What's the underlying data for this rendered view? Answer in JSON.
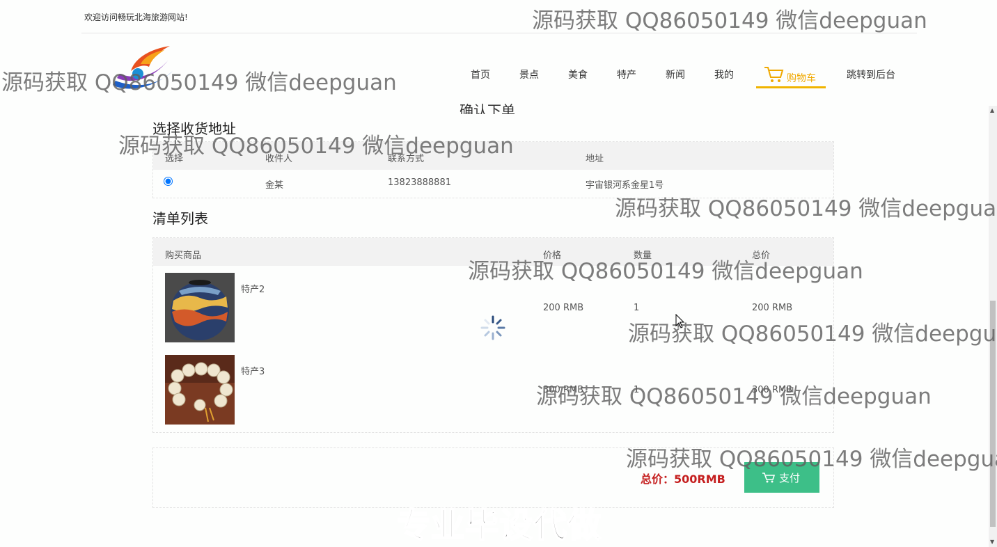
{
  "header": {
    "welcome": "欢迎访问畅玩北海旅游网站!",
    "nav": [
      "首页",
      "景点",
      "美食",
      "特产",
      "新闻",
      "我的"
    ],
    "cart_label": "购物车",
    "admin_link": "跳转到后台"
  },
  "page_heading": "确认下单",
  "address_section": {
    "title": "选择收货地址",
    "columns": [
      "选择",
      "收件人",
      "联系方式",
      "地址"
    ],
    "rows": [
      {
        "selected": true,
        "recipient": "金某",
        "phone": "13823888881",
        "address": "宇宙银河系金星1号"
      }
    ]
  },
  "order_section": {
    "title": "清单列表",
    "columns": [
      "购买商品",
      "价格",
      "数量",
      "总价"
    ],
    "items": [
      {
        "name": "特产2",
        "price": "200 RMB",
        "qty": "1",
        "total": "200 RMB",
        "image": "vase"
      },
      {
        "name": "特产3",
        "price": "300 RMB",
        "qty": "1",
        "total": "300 RMB",
        "image": "bead-bracelet"
      }
    ]
  },
  "summary": {
    "total": "总价：500RMB",
    "pay_label": "支付"
  },
  "watermark": "源码获取 QQ86050149 微信deepguan",
  "promo": "专业毕设代做",
  "colors": {
    "accent": "#f0b400",
    "pay_button": "#3dbf88",
    "total_text": "#c51f1f"
  }
}
